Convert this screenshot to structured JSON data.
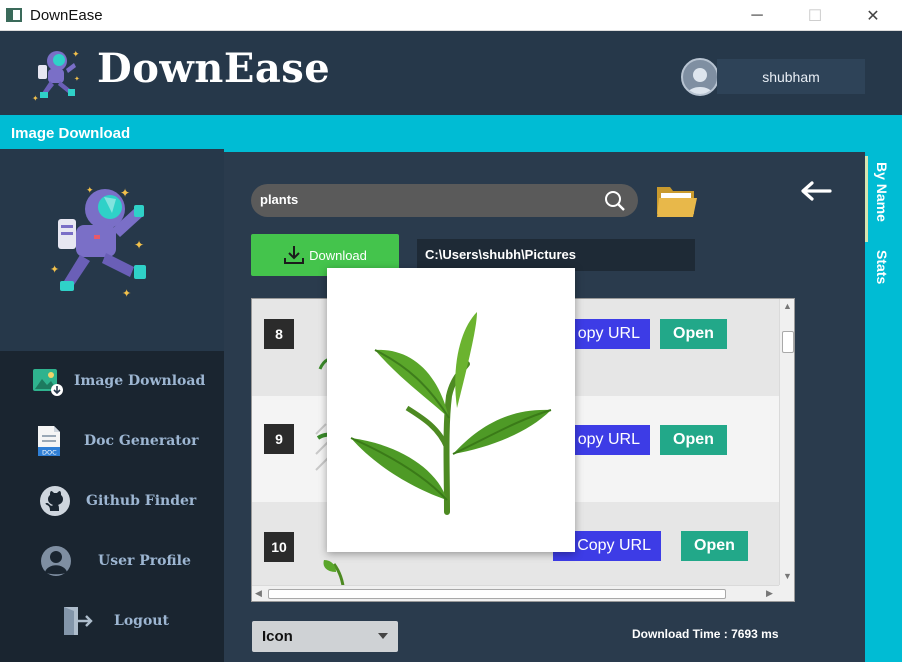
{
  "window": {
    "title": "DownEase",
    "minimize": "─",
    "maximize": "☐",
    "close": "✕"
  },
  "header": {
    "brand": "DownEase",
    "username": "shubham"
  },
  "section": {
    "title": "Image Download"
  },
  "sidebar": {
    "items": [
      {
        "label": "Image Download",
        "icon": "image-download-icon"
      },
      {
        "label": "Doc   Generator",
        "icon": "document-icon"
      },
      {
        "label": "Github  Finder",
        "icon": "github-icon"
      },
      {
        "label": "User  Profile",
        "icon": "user-icon"
      },
      {
        "label": "Logout",
        "icon": "logout-icon"
      }
    ]
  },
  "search": {
    "value": "plants"
  },
  "download": {
    "label": "Download",
    "path": "C:\\Users\\shubh\\Pictures"
  },
  "results": [
    {
      "index": "8",
      "copy_label": "opy URL",
      "open_label": "Open"
    },
    {
      "index": "9",
      "copy_label": "opy URL",
      "open_label": "Open"
    },
    {
      "index": "10",
      "copy_label": "Copy URL",
      "open_label": "Open"
    }
  ],
  "footer": {
    "type_value": "Icon",
    "download_time": "Download Time : 7693 ms"
  },
  "tabs": [
    {
      "label": "By Name",
      "active": true
    },
    {
      "label": "Stats",
      "active": false
    }
  ],
  "colors": {
    "accent": "#00bcd4",
    "download": "#44c44c",
    "copy": "#3d3ce6",
    "open": "#22a889",
    "background": "#2a3b4d"
  }
}
